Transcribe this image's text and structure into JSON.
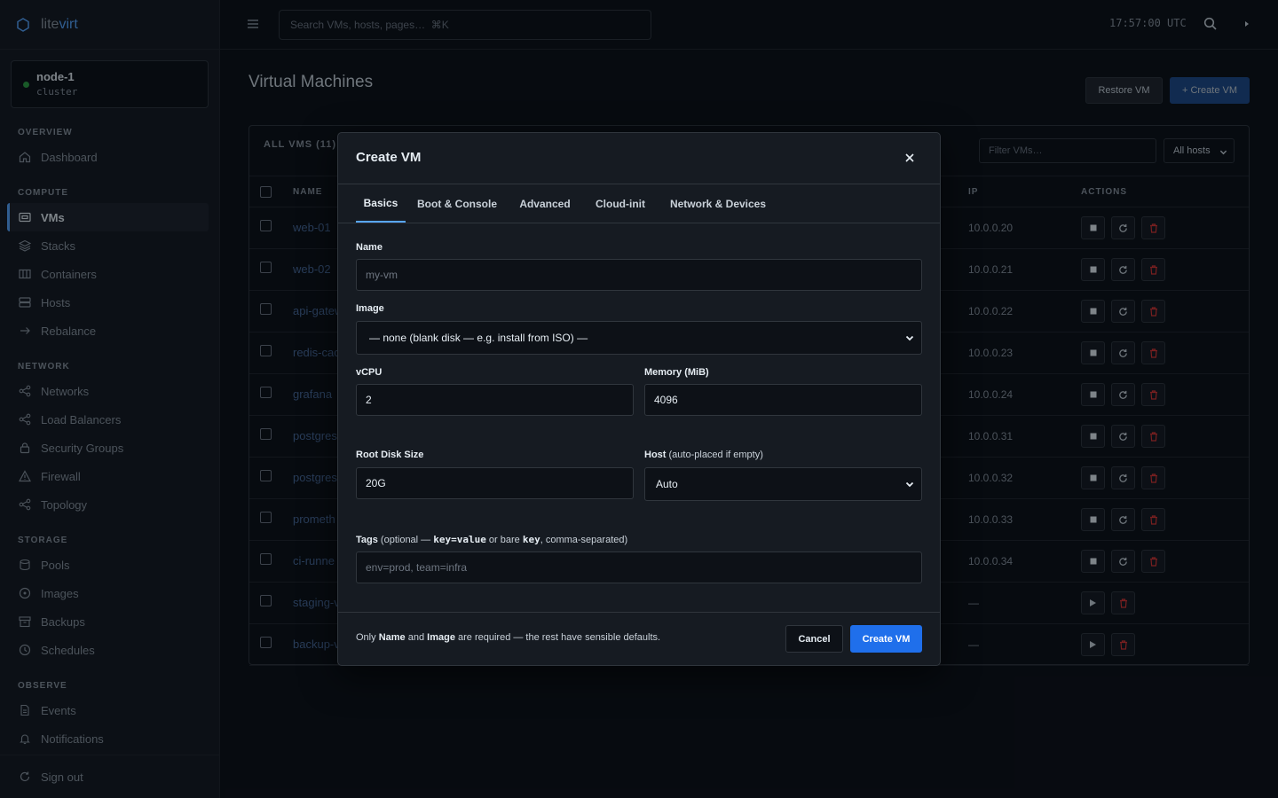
{
  "brand": {
    "prefix": "lite",
    "suffix": "virt"
  },
  "node": {
    "name": "node-1",
    "role": "cluster",
    "status_color": "#2ea043"
  },
  "sidebar": {
    "sections": {
      "overview": "OVERVIEW",
      "compute": "COMPUTE",
      "network": "NETWORK",
      "storage": "STORAGE",
      "observe": "OBSERVE"
    },
    "items": [
      {
        "label": "Dashboard",
        "icon": "home-icon"
      },
      {
        "label": "VMs",
        "icon": "vm-icon"
      },
      {
        "label": "Stacks",
        "icon": "stack-icon"
      },
      {
        "label": "Containers",
        "icon": "container-icon"
      },
      {
        "label": "Hosts",
        "icon": "server-icon"
      },
      {
        "label": "Rebalance",
        "icon": "arrow-right-icon"
      },
      {
        "label": "Networks",
        "icon": "share-icon"
      },
      {
        "label": "Load Balancers",
        "icon": "share-icon"
      },
      {
        "label": "Security Groups",
        "icon": "lock-icon"
      },
      {
        "label": "Firewall",
        "icon": "warning-icon"
      },
      {
        "label": "Topology",
        "icon": "share-icon"
      },
      {
        "label": "Pools",
        "icon": "database-icon"
      },
      {
        "label": "Images",
        "icon": "disc-icon"
      },
      {
        "label": "Backups",
        "icon": "archive-icon"
      },
      {
        "label": "Schedules",
        "icon": "clock-icon"
      },
      {
        "label": "Events",
        "icon": "document-icon"
      },
      {
        "label": "Notifications",
        "icon": "bell-icon"
      }
    ],
    "signout": "Sign out"
  },
  "topbar": {
    "search_placeholder": "Search VMs, hosts, pages…  ⌘K",
    "clock": "17:57:00 UTC"
  },
  "main": {
    "title": "Virtual Machines",
    "restore_label": "Restore VM",
    "create_label": "+ Create VM",
    "list_title": "ALL VMS (11)",
    "filter_placeholder": "Filter VMs…",
    "hosts_select": "All hosts",
    "columns": {
      "name": "NAME",
      "ip": "IP",
      "actions": "ACTIONS"
    },
    "rows": [
      {
        "name": "web-01",
        "ip": "10.0.0.20",
        "running": true
      },
      {
        "name": "web-02",
        "ip": "10.0.0.21",
        "running": true
      },
      {
        "name": "api-gatew",
        "ip": "10.0.0.22",
        "running": true
      },
      {
        "name": "redis-cac",
        "ip": "10.0.0.23",
        "running": true
      },
      {
        "name": "grafana",
        "ip": "10.0.0.24",
        "running": true
      },
      {
        "name": "postgres",
        "ip": "10.0.0.31",
        "running": true
      },
      {
        "name": "postgres",
        "ip": "10.0.0.32",
        "running": true
      },
      {
        "name": "prometh",
        "ip": "10.0.0.33",
        "running": true
      },
      {
        "name": "ci-runne",
        "ip": "10.0.0.34",
        "running": true
      },
      {
        "name": "staging-v",
        "ip": "—",
        "running": false
      },
      {
        "name": "backup-v",
        "ip": "—",
        "running": false
      }
    ]
  },
  "modal": {
    "title": "Create VM",
    "tabs": [
      "Basics",
      "Boot & Console",
      "Advanced",
      "Cloud-init",
      "Network & Devices"
    ],
    "active_tab": "Basics",
    "fields": {
      "name_label": "Name",
      "name_placeholder": "my-vm",
      "image_label": "Image",
      "image_value": "— none (blank disk — e.g. install from ISO) —",
      "vcpu_label": "vCPU",
      "vcpu_value": "2",
      "memory_label": "Memory (MiB)",
      "memory_value": "4096",
      "disk_label": "Root Disk Size",
      "disk_value": "20G",
      "host_label": "Host",
      "host_hint": "(auto-placed if empty)",
      "host_value": "Auto",
      "tags_label": "Tags",
      "tags_hint_a": "(optional —",
      "tags_code_a": "key=value",
      "tags_hint_b": "or bare",
      "tags_code_b": "key",
      "tags_hint_c": ", comma-separated)",
      "tags_placeholder": "env=prod, team=infra"
    },
    "footer": {
      "a": "Only",
      "b": "Name",
      "c": "and",
      "d": "Image",
      "e": "are required — the rest have sensible defaults."
    },
    "cancel_label": "Cancel",
    "create_label": "Create VM"
  },
  "colors": {
    "accent": "#58a6ff",
    "primary": "#1f6feb",
    "danger": "#da3633",
    "bg": "#0d1117"
  }
}
